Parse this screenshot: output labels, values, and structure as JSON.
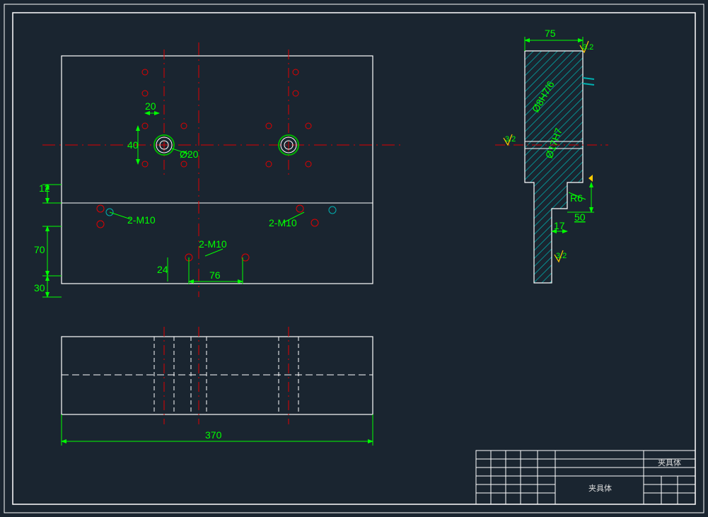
{
  "drawing": {
    "title_block": {
      "part_name_top": "夹具体",
      "part_name_bottom": "夹具体"
    },
    "front_view": {
      "dims": {
        "d12": "12",
        "d20h": "20",
        "d40": "40",
        "d20_dia": "Ø20",
        "d70": "70",
        "d30": "30",
        "d24": "24",
        "d76": "76",
        "d370": "370"
      },
      "labels": {
        "m10_left": "2-M10",
        "m10_right": "2-M10",
        "m10_center": "2-M10"
      }
    },
    "bottom_view": {},
    "side_view": {
      "dims": {
        "d75": "75",
        "d17H7": "Ø17H7",
        "d8H7_6": "Ø8H7/6",
        "dR6": "R6",
        "d50": "50",
        "d17": "17"
      },
      "surface_mark_1": "3.2",
      "surface_mark_2": "3.2",
      "surface_mark_3": "3.2"
    }
  }
}
